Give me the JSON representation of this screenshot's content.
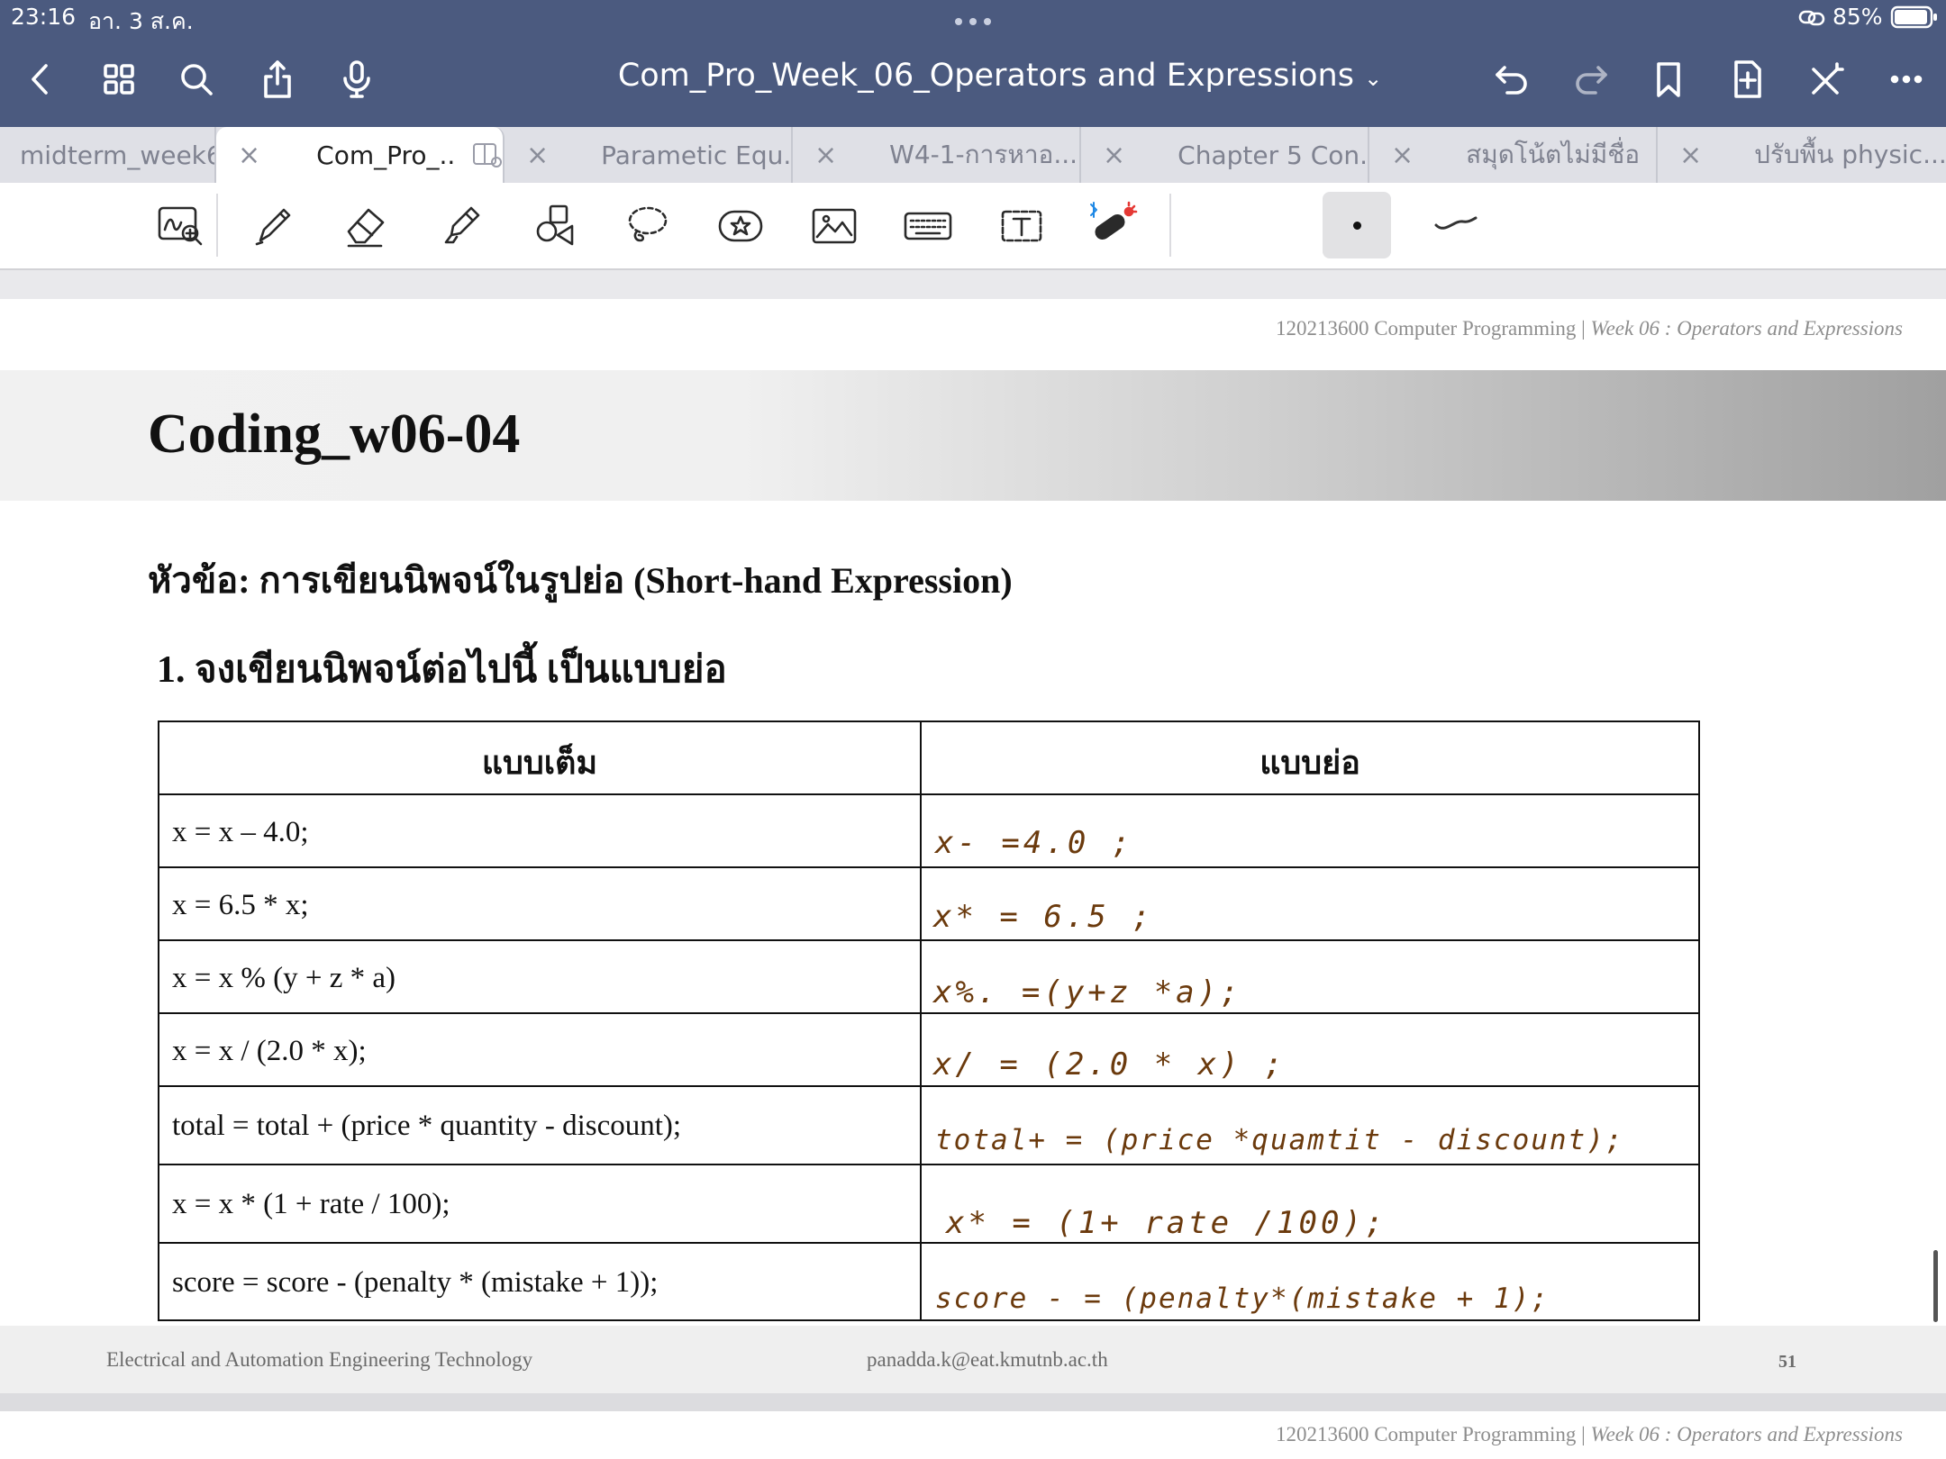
{
  "status_bar": {
    "time": "23:16",
    "date": "อา. 3 ส.ค.",
    "battery": "85%"
  },
  "nav": {
    "title": "Com_Pro_Week_06_Operators and Expressions"
  },
  "tabs": [
    {
      "label": "midterm_week6",
      "active": false
    },
    {
      "label": "Com_Pro_...",
      "active": true
    },
    {
      "label": "Parametic Equ...",
      "active": false
    },
    {
      "label": "W4-1-การหาอ...",
      "active": false
    },
    {
      "label": "Chapter 5 Con...",
      "active": false
    },
    {
      "label": "สมุดโน้ตไม่มีชื่อ",
      "active": false
    },
    {
      "label": "ปรับพื้น physic...",
      "active": false
    }
  ],
  "tab_close_symbol": "×",
  "page": {
    "header_course": "120213600 Computer Programming | ",
    "header_week": "Week 06 : Operators and Expressions",
    "banner_title": "Coding_w06-04",
    "subtitle": "หัวข้อ: การเขียนนิพจน์ในรูปย่อ (Short-hand Expression)",
    "question": "1. จงเขียนนิพจน์ต่อไปนี้ เป็นแบบย่อ",
    "table": {
      "headers": [
        "แบบเต็ม",
        "แบบย่อ"
      ],
      "rows": [
        {
          "full": "x = x – 4.0;",
          "short": "x- =4.0 ;"
        },
        {
          "full": "x = 6.5 * x;",
          "short": "x* = 6.5 ;"
        },
        {
          "full": "x = x % (y + z * a)",
          "short": "x%. =(y+z *a);"
        },
        {
          "full": "x = x / (2.0 * x);",
          "short": "x/ = (2.0 * x) ;"
        },
        {
          "full": "total = total + (price * quantity - discount);",
          "short": "total+ = (price *quamtit - discount);"
        },
        {
          "full": "x = x * (1 + rate / 100);",
          "short": "x* = (1+ rate /100);"
        },
        {
          "full": "score = score - (penalty * (mistake + 1));",
          "short": "score - = (penalty*(mistake + 1);"
        }
      ]
    },
    "footer_left": "Electrical and Automation Engineering Technology",
    "footer_center": "panadda.k@eat.kmutnb.ac.th",
    "footer_page": "51"
  },
  "colors": {
    "nav_bg": "#4b5a7f",
    "ink": "#6b3a0d"
  }
}
